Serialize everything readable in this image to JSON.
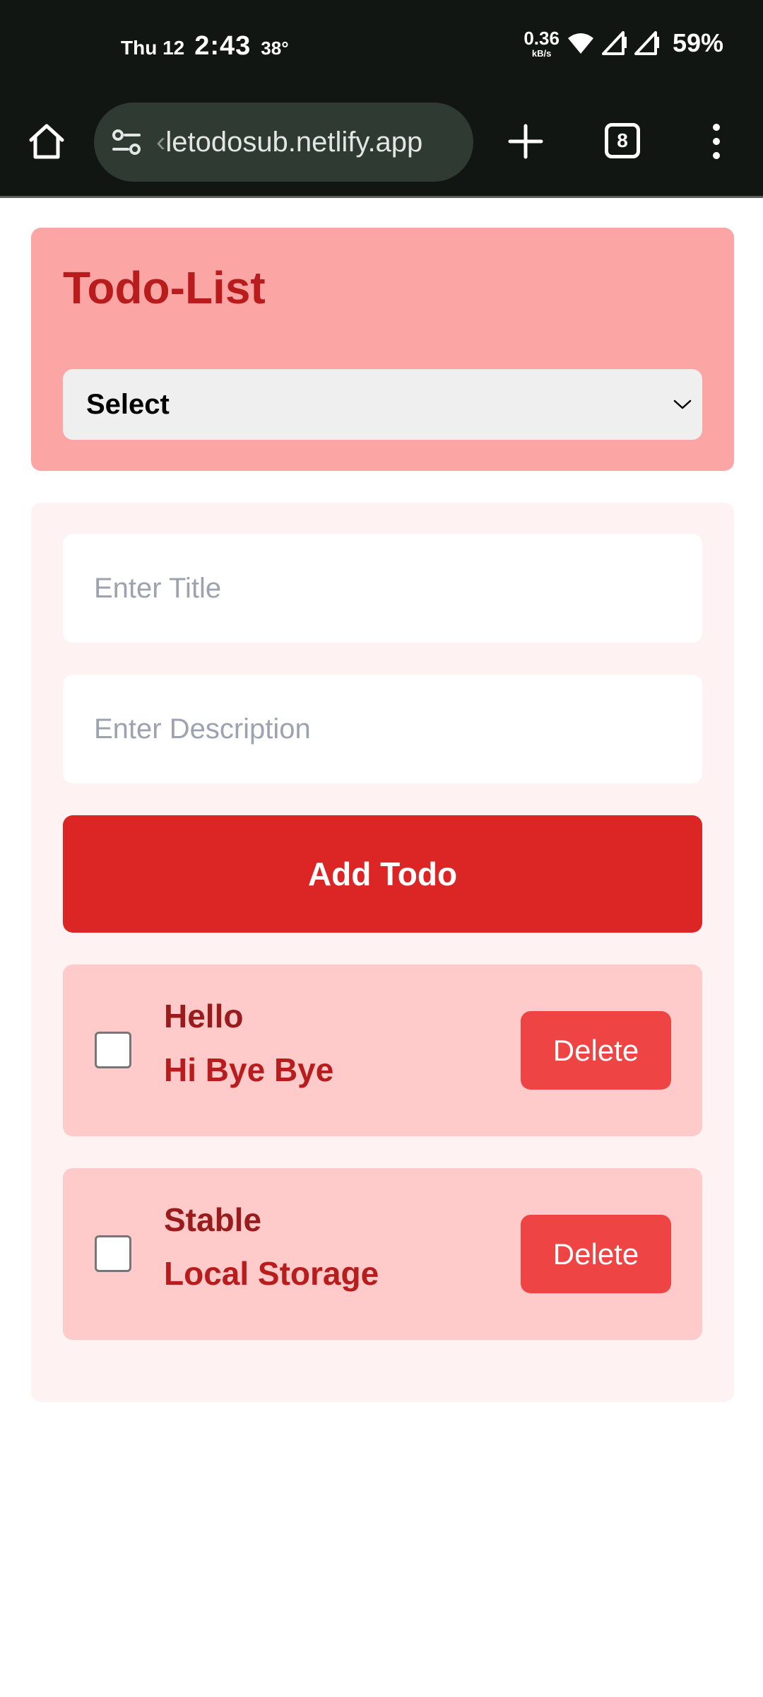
{
  "status_bar": {
    "day": "Thu 12",
    "time": "2:43",
    "temperature": "38°",
    "net_speed_value": "0.36",
    "net_speed_unit": "kB/s",
    "battery": "59%",
    "icons": [
      "wifi-icon",
      "signal-icon",
      "signal-icon",
      "battery-text"
    ]
  },
  "browser": {
    "url_hidden_prefix": "‹",
    "url_visible": "letodosub.netlify.app",
    "tab_count": "8",
    "icons": [
      "home-icon",
      "site-settings-icon",
      "plus-icon",
      "tabs-icon",
      "more-vert-icon"
    ]
  },
  "app": {
    "title": "Todo-List",
    "filter_select": {
      "selected": "Select"
    },
    "form": {
      "title_placeholder": "Enter Title",
      "description_placeholder": "Enter Description",
      "add_button_label": "Add Todo"
    },
    "todos": [
      {
        "title": "Hello",
        "description": "Hi Bye Bye",
        "checked": false,
        "delete_label": "Delete"
      },
      {
        "title": "Stable",
        "description": "Local Storage",
        "checked": false,
        "delete_label": "Delete"
      }
    ]
  },
  "colors": {
    "header_bg": "#fca5a5",
    "title_color": "#b91c1c",
    "card_bg": "#fef2f2",
    "primary_button": "#dc2626",
    "todo_bg": "#fecaca",
    "delete_button": "#ef4444",
    "browser_bg": "#121613"
  }
}
